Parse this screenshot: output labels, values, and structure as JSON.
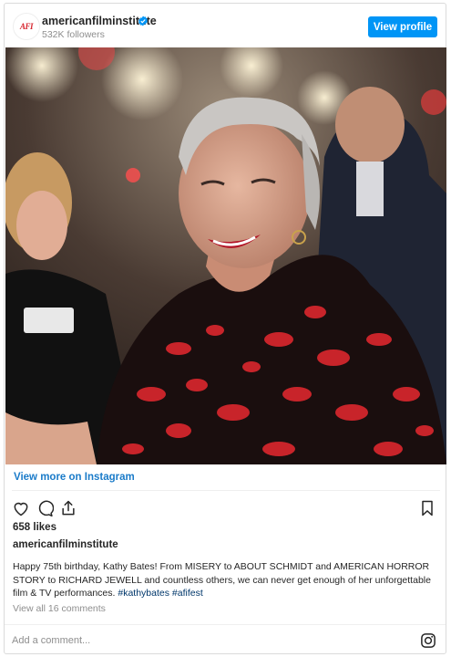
{
  "header": {
    "avatar_text": "AFI",
    "account_name": "americanfilminstitute",
    "followers": "532K followers",
    "view_profile_label": "View profile"
  },
  "post": {
    "image_description_icon": "photo",
    "view_more_label": "View more on Instagram",
    "likes": "658 likes",
    "caption_user": "americanfilminstitute",
    "caption_text": "Happy 75th birthday, Kathy Bates! From MISERY to ABOUT SCHMIDT and AMERICAN HORROR STORY to RICHARD JEWELL and countless others, we can never get enough of her unforgettable film & TV performances.",
    "hashtags": [
      "#kathybates",
      "#afifest"
    ],
    "view_comments": "View all 16 comments"
  },
  "comment": {
    "placeholder": "Add a comment..."
  },
  "icons": {
    "verified": "verified-badge-icon",
    "like": "heart-icon",
    "comment": "comment-icon",
    "share": "share-icon",
    "save": "bookmark-icon",
    "instagram": "instagram-icon"
  },
  "colors": {
    "button_blue": "#0095f6",
    "link_blue": "#1a7bc9",
    "hashtag": "#00376b",
    "muted": "#8e8e8e",
    "afi_red": "#d7262f"
  }
}
